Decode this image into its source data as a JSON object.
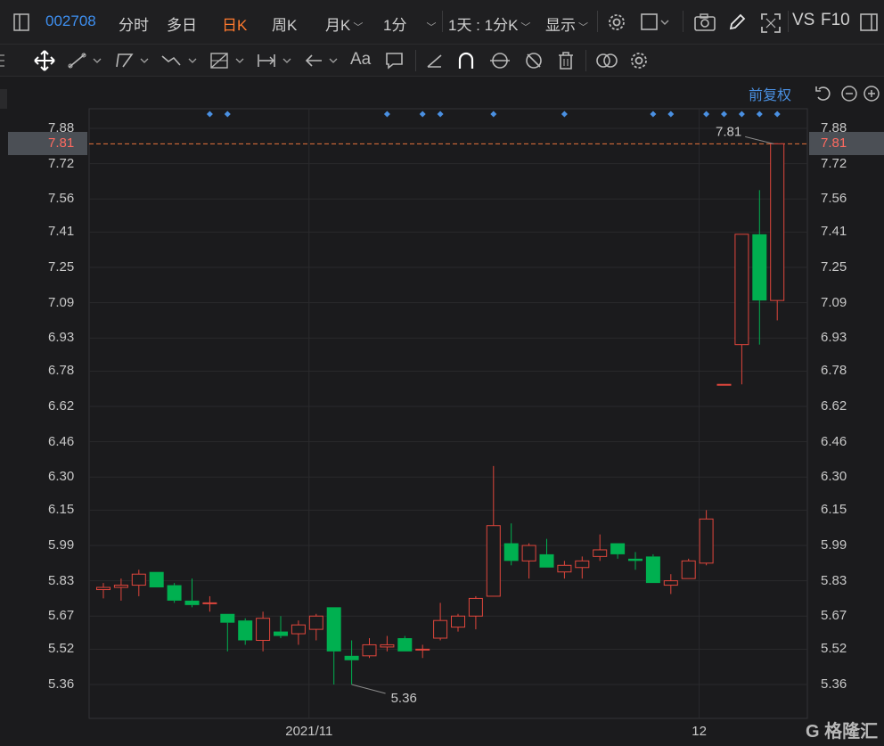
{
  "toolbar": {
    "code": "002708",
    "tabs": [
      "分时",
      "多日",
      "日K",
      "周K"
    ],
    "active_tab": "日K",
    "month_k": "月K",
    "minute": "1分",
    "day_range": "1天 : 1分K",
    "display": "显示",
    "vs": "VS",
    "f10": "F10"
  },
  "adjust_label": "前复权",
  "watermark": "格隆汇",
  "colors": {
    "up": "#e0463c",
    "down": "#00b050",
    "marker": "#4a90e2",
    "current_line": "#e8743c"
  },
  "chart_data": {
    "type": "candlestick",
    "current_price": "7.81",
    "y_ticks": [
      "7.88",
      "7.72",
      "7.56",
      "7.41",
      "7.25",
      "7.09",
      "6.93",
      "6.78",
      "6.62",
      "6.46",
      "6.30",
      "6.15",
      "5.99",
      "5.83",
      "5.67",
      "5.52",
      "5.36"
    ],
    "ylim": [
      5.2,
      7.95
    ],
    "x_labels": [
      {
        "label": "2021/11",
        "index": 12
      },
      {
        "label": "12",
        "index": 34
      }
    ],
    "annotations": [
      {
        "text": "7.81",
        "kind": "high",
        "index": 38
      },
      {
        "text": "5.36",
        "kind": "low",
        "index": 14
      }
    ],
    "marker_indices": [
      6,
      7,
      16,
      18,
      19,
      22,
      26,
      31,
      32,
      34,
      35,
      36,
      37,
      38
    ],
    "candles": [
      {
        "o": 5.79,
        "h": 5.82,
        "l": 5.75,
        "c": 5.8
      },
      {
        "o": 5.8,
        "h": 5.84,
        "l": 5.74,
        "c": 5.81
      },
      {
        "o": 5.81,
        "h": 5.88,
        "l": 5.76,
        "c": 5.86
      },
      {
        "o": 5.87,
        "h": 5.87,
        "l": 5.8,
        "c": 5.8
      },
      {
        "o": 5.81,
        "h": 5.82,
        "l": 5.73,
        "c": 5.74
      },
      {
        "o": 5.74,
        "h": 5.84,
        "l": 5.71,
        "c": 5.72
      },
      {
        "o": 5.73,
        "h": 5.76,
        "l": 5.69,
        "c": 5.73
      },
      {
        "o": 5.68,
        "h": 5.68,
        "l": 5.51,
        "c": 5.64
      },
      {
        "o": 5.65,
        "h": 5.66,
        "l": 5.54,
        "c": 5.56
      },
      {
        "o": 5.56,
        "h": 5.69,
        "l": 5.51,
        "c": 5.66
      },
      {
        "o": 5.6,
        "h": 5.67,
        "l": 5.57,
        "c": 5.58
      },
      {
        "o": 5.59,
        "h": 5.65,
        "l": 5.54,
        "c": 5.63
      },
      {
        "o": 5.61,
        "h": 5.68,
        "l": 5.56,
        "c": 5.67
      },
      {
        "o": 5.71,
        "h": 5.71,
        "l": 5.36,
        "c": 5.51
      },
      {
        "o": 5.49,
        "h": 5.56,
        "l": 5.36,
        "c": 5.47
      },
      {
        "o": 5.49,
        "h": 5.57,
        "l": 5.48,
        "c": 5.54
      },
      {
        "o": 5.53,
        "h": 5.58,
        "l": 5.51,
        "c": 5.54
      },
      {
        "o": 5.57,
        "h": 5.58,
        "l": 5.51,
        "c": 5.51
      },
      {
        "o": 5.52,
        "h": 5.54,
        "l": 5.48,
        "c": 5.52
      },
      {
        "o": 5.57,
        "h": 5.73,
        "l": 5.56,
        "c": 5.65
      },
      {
        "o": 5.62,
        "h": 5.68,
        "l": 5.6,
        "c": 5.67
      },
      {
        "o": 5.67,
        "h": 5.76,
        "l": 5.61,
        "c": 5.75
      },
      {
        "o": 5.76,
        "h": 6.35,
        "l": 5.76,
        "c": 6.08
      },
      {
        "o": 6.0,
        "h": 6.09,
        "l": 5.9,
        "c": 5.92
      },
      {
        "o": 5.92,
        "h": 6.0,
        "l": 5.84,
        "c": 5.99
      },
      {
        "o": 5.95,
        "h": 6.02,
        "l": 5.89,
        "c": 5.89
      },
      {
        "o": 5.87,
        "h": 5.92,
        "l": 5.84,
        "c": 5.9
      },
      {
        "o": 5.89,
        "h": 5.94,
        "l": 5.84,
        "c": 5.92
      },
      {
        "o": 5.94,
        "h": 6.04,
        "l": 5.92,
        "c": 5.97
      },
      {
        "o": 6.0,
        "h": 6.0,
        "l": 5.93,
        "c": 5.95
      },
      {
        "o": 5.93,
        "h": 5.96,
        "l": 5.88,
        "c": 5.92
      },
      {
        "o": 5.94,
        "h": 5.95,
        "l": 5.82,
        "c": 5.82
      },
      {
        "o": 5.81,
        "h": 5.86,
        "l": 5.77,
        "c": 5.83
      },
      {
        "o": 5.84,
        "h": 5.93,
        "l": 5.84,
        "c": 5.92
      },
      {
        "o": 5.91,
        "h": 6.15,
        "l": 5.9,
        "c": 6.11
      },
      {
        "o": 6.72,
        "h": 6.72,
        "l": 6.72,
        "c": 6.72
      },
      {
        "o": 6.9,
        "h": 7.4,
        "l": 6.72,
        "c": 7.4
      },
      {
        "o": 7.4,
        "h": 7.6,
        "l": 6.9,
        "c": 7.1
      },
      {
        "o": 7.1,
        "h": 7.81,
        "l": 7.01,
        "c": 7.81
      }
    ]
  }
}
